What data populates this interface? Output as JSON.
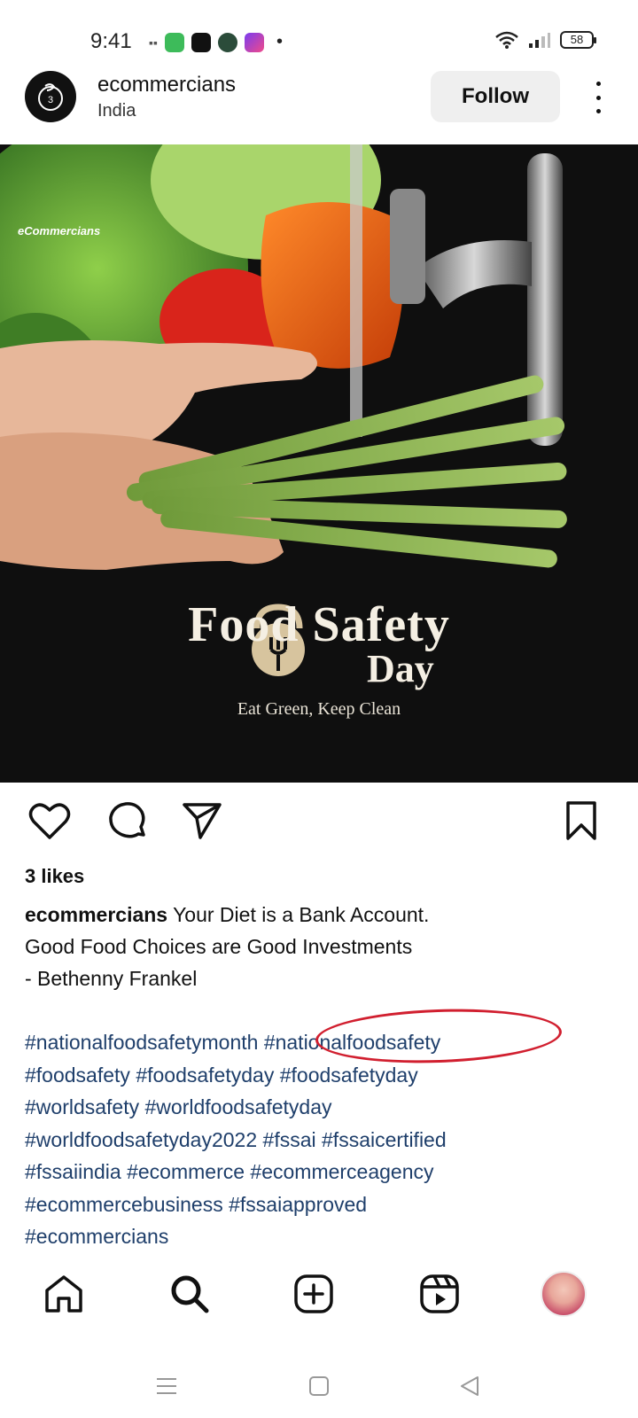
{
  "status_bar": {
    "time": "9:41",
    "battery": "58"
  },
  "post": {
    "username": "ecommercians",
    "location": "India",
    "follow_label": "Follow",
    "image": {
      "brand": "eCommercians",
      "title": "Food Safety",
      "title_day": "Day",
      "tagline": "Eat Green, Keep Clean"
    },
    "likes": "3 likes",
    "caption_user": "ecommercians",
    "caption_line1": " Your Diet is a Bank Account.",
    "caption_line2": "Good Food Choices are Good Investments",
    "caption_line3": "- Bethenny Frankel",
    "hashtags": [
      "#nationalfoodsafetymonth",
      "#nationalfoodsafety",
      "#foodsafety",
      "#foodsafetyday",
      "#foodsafetyday",
      "#worldsafety",
      "#worldfoodsafetyday",
      "#worldfoodsafetyday2022",
      "#fssai",
      "#fssaicertified",
      "#fssaiindia",
      "#ecommerce",
      "#ecommerceagency",
      "#ecommercebusiness",
      "#fssaiapproved",
      "#ecommercians"
    ]
  },
  "icons": {
    "like": "heart-icon",
    "comment": "comment-icon",
    "share": "send-icon",
    "save": "bookmark-icon",
    "home": "home-icon",
    "search": "search-icon",
    "create": "plus-square-icon",
    "reels": "reels-icon",
    "profile": "avatar"
  },
  "colors": {
    "hashtag": "#1f3f6b",
    "highlight_oval": "#d11f2f",
    "follow_bg": "#efefef"
  }
}
